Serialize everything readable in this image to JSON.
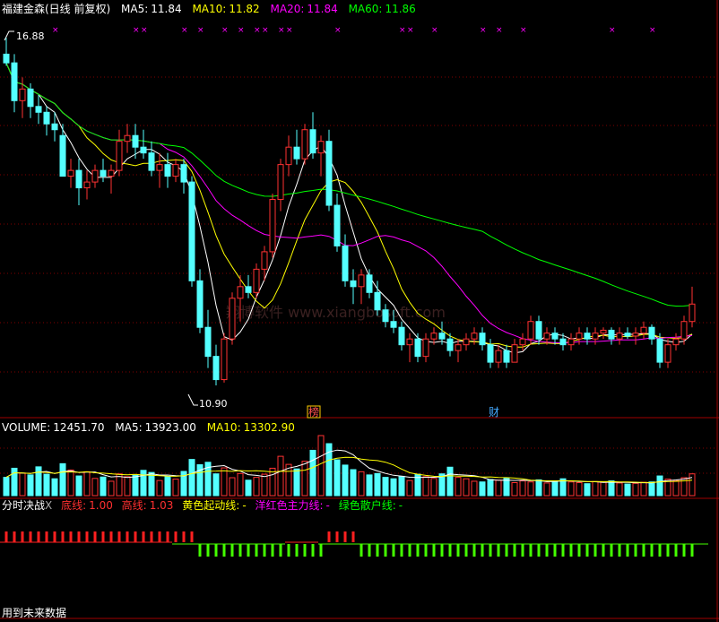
{
  "header": {
    "stock_title": "福建金森(日线 前复权)",
    "ma5": {
      "label": "MA5:",
      "value": "11.84",
      "color": "#ffffff"
    },
    "ma10": {
      "label": "MA10:",
      "value": "11.82",
      "color": "#ffff00"
    },
    "ma20": {
      "label": "MA20:",
      "value": "11.84",
      "color": "#ff00ff"
    },
    "ma60": {
      "label": "MA60:",
      "value": "11.86",
      "color": "#00ff00"
    }
  },
  "price_panel": {
    "high_label": "16.88",
    "low_label": "10.90",
    "watermark": "翔博软件 www.xiangbosoft.com",
    "event_marks": [
      {
        "text": "榜",
        "color": "#ff5050"
      },
      {
        "text": "财",
        "color": "#44aaff"
      }
    ]
  },
  "volume_header": {
    "volume": {
      "label": "VOLUME:",
      "value": "12451.70",
      "color": "#ffffff"
    },
    "ma5": {
      "label": "MA5:",
      "value": "13923.00",
      "color": "#ffffff"
    },
    "ma10": {
      "label": "MA10:",
      "value": "13302.90",
      "color": "#ffff00"
    }
  },
  "indicator_header": {
    "name": "分时决战",
    "close_mark": "X",
    "items": [
      {
        "label": "底线:",
        "value": "1.00",
        "color": "#ff3030"
      },
      {
        "label": "高线:",
        "value": "1.03",
        "color": "#ff3030"
      },
      {
        "label": "黄色起动线:",
        "value": "-",
        "color": "#ffff00"
      },
      {
        "label": "洋红色主力线:",
        "value": "-",
        "color": "#ff00ff"
      },
      {
        "label": "绿色散户线:",
        "value": "-",
        "color": "#00ff00"
      }
    ]
  },
  "footer": {
    "note": "用到未来数据"
  },
  "colors": {
    "up": "#ff3232",
    "down": "#54ffff",
    "ma5": "#ffffff",
    "ma10": "#ffff00",
    "ma20": "#ff00ff",
    "ma60": "#00ff00",
    "grid": "#800000",
    "indicator_up": "#ff2020",
    "indicator_down": "#44ff00",
    "cross": "#ff00ff"
  },
  "chart_data": {
    "type": "candlestick",
    "ylim": [
      10.5,
      17.1
    ],
    "candles": [
      [
        16.6,
        16.88,
        16.4,
        16.45
      ],
      [
        16.45,
        16.6,
        15.6,
        15.8
      ],
      [
        15.8,
        16.2,
        15.5,
        16.0
      ],
      [
        16.0,
        16.1,
        15.5,
        15.7
      ],
      [
        15.7,
        15.9,
        15.4,
        15.6
      ],
      [
        15.6,
        15.7,
        15.2,
        15.4
      ],
      [
        15.4,
        15.6,
        15.1,
        15.3
      ],
      [
        15.2,
        15.4,
        14.5,
        14.5
      ],
      [
        14.5,
        14.8,
        14.3,
        14.6
      ],
      [
        14.6,
        14.8,
        14.0,
        14.3
      ],
      [
        14.3,
        14.6,
        14.1,
        14.4
      ],
      [
        14.4,
        14.7,
        14.3,
        14.6
      ],
      [
        14.6,
        14.8,
        14.4,
        14.5
      ],
      [
        14.5,
        14.7,
        14.2,
        14.6
      ],
      [
        14.6,
        15.3,
        14.5,
        15.1
      ],
      [
        15.1,
        15.4,
        14.9,
        15.2
      ],
      [
        15.2,
        15.4,
        14.8,
        15.0
      ],
      [
        15.0,
        15.3,
        14.8,
        14.9
      ],
      [
        14.9,
        15.1,
        14.5,
        14.6
      ],
      [
        14.6,
        14.9,
        14.3,
        14.7
      ],
      [
        14.7,
        14.9,
        14.3,
        14.5
      ],
      [
        14.5,
        14.8,
        14.4,
        14.7
      ],
      [
        14.7,
        14.8,
        14.2,
        14.4
      ],
      [
        14.4,
        14.5,
        12.6,
        12.7
      ],
      [
        12.7,
        12.9,
        11.8,
        11.9
      ],
      [
        11.9,
        12.2,
        11.2,
        11.4
      ],
      [
        11.4,
        11.6,
        10.9,
        11.0
      ],
      [
        11.0,
        11.8,
        10.95,
        11.7
      ],
      [
        11.7,
        12.5,
        11.6,
        12.4
      ],
      [
        12.4,
        12.8,
        12.0,
        12.6
      ],
      [
        12.6,
        12.8,
        12.4,
        12.5
      ],
      [
        12.5,
        13.0,
        12.4,
        12.9
      ],
      [
        12.9,
        13.3,
        12.7,
        13.2
      ],
      [
        13.2,
        14.2,
        13.1,
        14.1
      ],
      [
        14.1,
        14.8,
        13.9,
        14.7
      ],
      [
        14.7,
        15.2,
        14.5,
        15.0
      ],
      [
        15.0,
        15.3,
        14.7,
        14.8
      ],
      [
        14.8,
        15.4,
        14.7,
        15.3
      ],
      [
        15.3,
        15.6,
        14.8,
        14.9
      ],
      [
        14.9,
        15.2,
        14.5,
        15.1
      ],
      [
        15.1,
        15.3,
        13.9,
        14.0
      ],
      [
        14.0,
        14.2,
        13.2,
        13.3
      ],
      [
        13.3,
        13.5,
        12.6,
        12.7
      ],
      [
        12.7,
        12.9,
        12.3,
        12.6
      ],
      [
        12.6,
        12.9,
        12.3,
        12.8
      ],
      [
        12.8,
        12.9,
        12.4,
        12.5
      ],
      [
        12.5,
        12.7,
        12.1,
        12.2
      ],
      [
        12.2,
        12.3,
        11.9,
        12.0
      ],
      [
        12.0,
        12.2,
        11.8,
        11.9
      ],
      [
        11.9,
        12.0,
        11.5,
        11.6
      ],
      [
        11.6,
        11.8,
        11.3,
        11.7
      ],
      [
        11.7,
        11.8,
        11.3,
        11.4
      ],
      [
        11.4,
        11.8,
        11.3,
        11.7
      ],
      [
        11.7,
        11.9,
        11.6,
        11.8
      ],
      [
        11.8,
        12.0,
        11.6,
        11.7
      ],
      [
        11.7,
        11.8,
        11.4,
        11.5
      ],
      [
        11.5,
        11.7,
        11.3,
        11.6
      ],
      [
        11.6,
        11.8,
        11.5,
        11.7
      ],
      [
        11.7,
        11.9,
        11.6,
        11.8
      ],
      [
        11.8,
        11.9,
        11.5,
        11.6
      ],
      [
        11.6,
        11.7,
        11.2,
        11.3
      ],
      [
        11.3,
        11.6,
        11.2,
        11.5
      ],
      [
        11.5,
        11.6,
        11.2,
        11.3
      ],
      [
        11.3,
        11.7,
        11.3,
        11.6
      ],
      [
        11.6,
        11.8,
        11.5,
        11.7
      ],
      [
        11.7,
        12.1,
        11.6,
        12.0
      ],
      [
        12.0,
        12.1,
        11.6,
        11.7
      ],
      [
        11.7,
        11.9,
        11.6,
        11.8
      ],
      [
        11.8,
        11.9,
        11.6,
        11.7
      ],
      [
        11.7,
        11.8,
        11.5,
        11.6
      ],
      [
        11.6,
        11.8,
        11.5,
        11.7
      ],
      [
        11.7,
        11.9,
        11.6,
        11.8
      ],
      [
        11.8,
        11.9,
        11.6,
        11.7
      ],
      [
        11.7,
        11.9,
        11.6,
        11.8
      ],
      [
        11.8,
        11.9,
        11.7,
        11.85
      ],
      [
        11.85,
        11.9,
        11.6,
        11.7
      ],
      [
        11.7,
        11.9,
        11.6,
        11.8
      ],
      [
        11.8,
        11.9,
        11.7,
        11.75
      ],
      [
        11.75,
        11.9,
        11.6,
        11.8
      ],
      [
        11.8,
        12.0,
        11.7,
        11.9
      ],
      [
        11.9,
        11.95,
        11.6,
        11.7
      ],
      [
        11.7,
        11.8,
        11.2,
        11.3
      ],
      [
        11.3,
        11.7,
        11.2,
        11.6
      ],
      [
        11.6,
        11.8,
        11.5,
        11.7
      ],
      [
        11.7,
        12.1,
        11.6,
        12.0
      ],
      [
        12.0,
        12.6,
        11.9,
        12.3
      ]
    ],
    "volumes": [
      5200,
      7800,
      6400,
      5900,
      8200,
      6100,
      4800,
      9100,
      7300,
      5600,
      6800,
      4900,
      5300,
      4100,
      6200,
      5400,
      5800,
      7200,
      6600,
      4300,
      5500,
      4700,
      6900,
      10300,
      8800,
      9500,
      6200,
      7900,
      5100,
      6300,
      4400,
      5200,
      6100,
      7800,
      11200,
      8900,
      7600,
      9800,
      12900,
      17100,
      14800,
      10200,
      8700,
      7400,
      6800,
      5900,
      6300,
      5200,
      4800,
      5500,
      4300,
      6100,
      5400,
      4900,
      6200,
      8100,
      5200,
      4800,
      4100,
      3900,
      4600,
      4400,
      5100,
      3700,
      4200,
      3900,
      4500,
      3600,
      4100,
      4800,
      3900,
      3700,
      3400,
      4000,
      3800,
      4200,
      3600,
      3300,
      3500,
      3800,
      3900,
      5600,
      4700,
      4300,
      5100,
      6200
    ],
    "indicator": [
      1,
      1,
      1,
      1,
      1,
      1,
      1,
      1,
      1,
      1,
      1,
      1,
      1,
      1,
      1,
      1,
      1,
      1,
      1,
      1,
      1,
      1,
      1,
      1,
      0,
      0,
      0,
      0,
      0,
      0,
      0,
      0,
      0,
      0,
      0,
      0,
      0,
      0,
      0,
      0,
      1,
      1,
      1,
      1,
      0,
      0,
      0,
      0,
      0,
      0,
      0,
      0,
      0,
      0,
      0,
      0,
      0,
      0,
      0,
      0,
      0,
      0,
      0,
      0,
      0,
      0,
      0,
      0,
      0,
      0,
      0,
      0,
      0,
      0,
      0,
      0,
      0,
      0,
      0,
      0,
      0,
      0,
      0,
      0,
      0,
      0
    ]
  }
}
